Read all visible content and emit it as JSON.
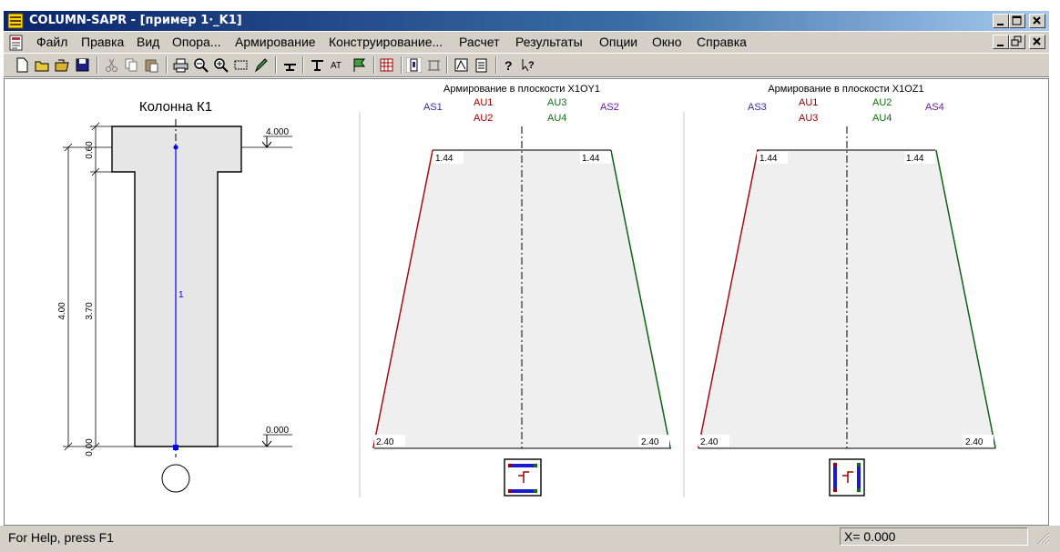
{
  "window": {
    "title": "COLUMN-SAPR - [пример 1·_K1]"
  },
  "menu": {
    "items": [
      "Файл",
      "Правка",
      "Вид",
      "Опора...",
      "Армирование",
      "Конструирование...",
      "Расчет",
      "Результаты",
      "Опции",
      "Окно",
      "Справка"
    ]
  },
  "column": {
    "title": "Колонна К1",
    "member_label": "1",
    "dim_total": "4.00",
    "dim_top": "0.60",
    "dim_shaft": "3.70",
    "dim_bottom": "0.00",
    "level_top": "4.000",
    "level_bottom": "0.000"
  },
  "panels": [
    {
      "title": "Армирование в плоскости  X1OY1",
      "labels": {
        "left_outer": "AS1",
        "left_top": "AU1",
        "left_bottom": "AU2",
        "right_top": "AU3",
        "right_bottom": "AU4",
        "right_outer": "AS2"
      },
      "left_top_value": 1.44,
      "right_top_value": 1.44,
      "left_bottom_value": 2.4,
      "right_bottom_value": 2.4,
      "left_top_text": "1.44",
      "right_top_text": "1.44",
      "left_bottom_text": "2.40",
      "right_bottom_text": "2.40"
    },
    {
      "title": "Армирование в плоскости  X1OZ1",
      "labels": {
        "left_outer": "AS3",
        "left_top": "AU1",
        "left_bottom": "AU3",
        "right_top": "AU2",
        "right_bottom": "AU4",
        "right_outer": "AS4"
      },
      "left_top_value": 1.44,
      "right_top_value": 1.44,
      "left_bottom_value": 2.4,
      "right_bottom_value": 2.4,
      "left_top_text": "1.44",
      "right_top_text": "1.44",
      "left_bottom_text": "2.40",
      "right_bottom_text": "2.40"
    }
  ],
  "colors": {
    "as_label": "#3a2aa0",
    "au_red": "#a00000",
    "au_green": "#107010",
    "as_right": "#6a1aa0",
    "left_line": "#a01010",
    "right_line": "#106010",
    "fill": "#efefef",
    "member_line": "#0000ff"
  },
  "status": {
    "help": "For Help, press F1",
    "x_readout": "X= 0.000"
  }
}
